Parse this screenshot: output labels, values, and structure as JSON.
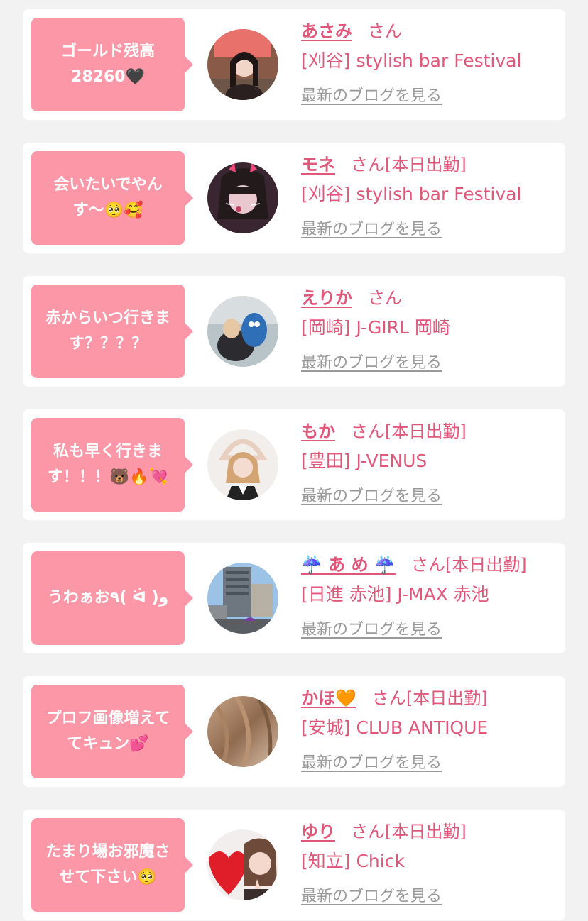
{
  "cards": [
    {
      "message": "ゴールド残高\n28260🖤",
      "name": "あさみ",
      "suffix": "さん",
      "shop": "[刈谷] stylish bar Festival",
      "blog_link": "最新のブログを見る",
      "avatar_icon": "girl-photo-avatar"
    },
    {
      "message": "会いたいでやん\nす〜🥺🥰",
      "name": "モネ",
      "suffix": "さん[本日出勤]",
      "shop": "[刈谷] stylish bar Festival",
      "blog_link": "最新のブログを見る",
      "avatar_icon": "girl-photo-avatar"
    },
    {
      "message": "赤からいつ行きま\nす？？？？",
      "name": "えりか",
      "suffix": "さん",
      "shop": "[岡崎] J-GIRL 岡崎",
      "blog_link": "最新のブログを見る",
      "avatar_icon": "girl-photo-avatar"
    },
    {
      "message": "私も早く行きま\nす！！！🐻🔥💘",
      "name": "もか",
      "suffix": "さん[本日出勤]",
      "shop": "[豊田] J-VENUS",
      "blog_link": "最新のブログを見る",
      "avatar_icon": "girl-photo-avatar"
    },
    {
      "message": "うわぁお٩( ᐛ )و",
      "name": "☔️ あ め ☔️",
      "suffix": "さん[本日出勤]",
      "shop": "[日進 赤池] J-MAX 赤池",
      "blog_link": "最新のブログを見る",
      "avatar_icon": "building-photo-avatar"
    },
    {
      "message": "プロフ画像増えて\nてキュン💕",
      "name": "かほ🧡",
      "suffix": "さん[本日出勤]",
      "shop": "[安城] CLUB ANTIQUE",
      "blog_link": "最新のブログを見る",
      "avatar_icon": "hair-photo-avatar"
    },
    {
      "message": "たまり場お邪魔さ\nせて下さい🥺",
      "name": "ゆり",
      "suffix": "さん[本日出勤]",
      "shop": "[知立] Chick",
      "blog_link": "最新のブログを見る",
      "avatar_icon": "girl-photo-avatar"
    }
  ],
  "colors": {
    "bubble": "#fb97a6",
    "accent": "#e0577a",
    "link_gray": "#999999",
    "background": "#f2f2f2"
  }
}
